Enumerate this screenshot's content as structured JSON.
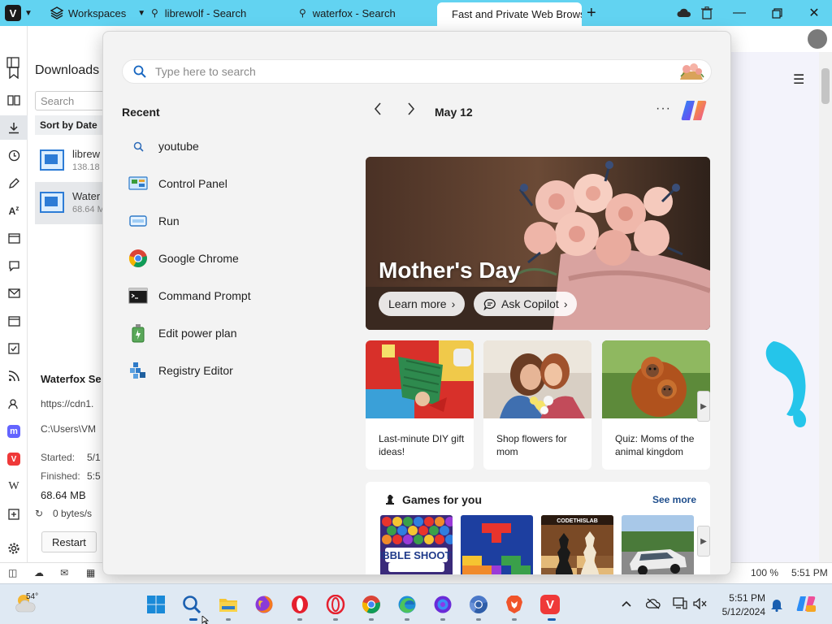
{
  "browser": {
    "workspaces_label": "Workspaces",
    "tabs": [
      {
        "label": "librewolf - Search"
      },
      {
        "label": "waterfox - Search"
      },
      {
        "label": "Fast and Private Web Brows"
      }
    ],
    "accent_color": "#62d3f1"
  },
  "downloads_panel": {
    "title": "Downloads",
    "search_placeholder": "Search",
    "sort_label": "Sort by Date",
    "items": [
      {
        "name": "librew",
        "size": "138.18"
      },
      {
        "name": "Water",
        "size": "68.64 M"
      }
    ],
    "detail": {
      "title": "Waterfox Se",
      "url": "https://cdn1.",
      "path": "C:\\Users\\VM",
      "started_label": "Started:",
      "started_value": "5/1",
      "finished_label": "Finished:",
      "finished_value": "5:5",
      "size": "68.64 MB",
      "speed": "0 bytes/s",
      "restart_label": "Restart"
    }
  },
  "statusbar": {
    "zoom": "100 %",
    "time": "5:51 PM"
  },
  "flyout": {
    "search_placeholder": "Type here to search",
    "recent_title": "Recent",
    "recent_items": [
      {
        "label": "youtube",
        "icon": "search-icon"
      },
      {
        "label": "Control Panel",
        "icon": "control-panel-icon"
      },
      {
        "label": "Run",
        "icon": "run-icon"
      },
      {
        "label": "Google Chrome",
        "icon": "chrome-icon"
      },
      {
        "label": "Command Prompt",
        "icon": "command-prompt-icon"
      },
      {
        "label": "Edit power plan",
        "icon": "power-plan-icon"
      },
      {
        "label": "Registry Editor",
        "icon": "registry-editor-icon"
      }
    ],
    "date": "May 12",
    "hero": {
      "title": "Mother's Day",
      "learn_more": "Learn more",
      "ask_copilot": "Ask Copilot"
    },
    "cards": [
      {
        "title": "Last-minute DIY gift ideas!"
      },
      {
        "title": "Shop flowers for mom"
      },
      {
        "title": "Quiz: Moms of the animal kingdom"
      }
    ],
    "games": {
      "title": "Games for you",
      "see_more": "See more",
      "items": [
        {
          "name": "BUBBLE SHOOTER"
        },
        {
          "name": "Blocks"
        },
        {
          "name": "CODETHISLAB"
        },
        {
          "name": "Racing"
        }
      ]
    }
  },
  "taskbar": {
    "weather_temp": "54°",
    "clock_time": "5:51 PM",
    "clock_date": "5/12/2024"
  }
}
